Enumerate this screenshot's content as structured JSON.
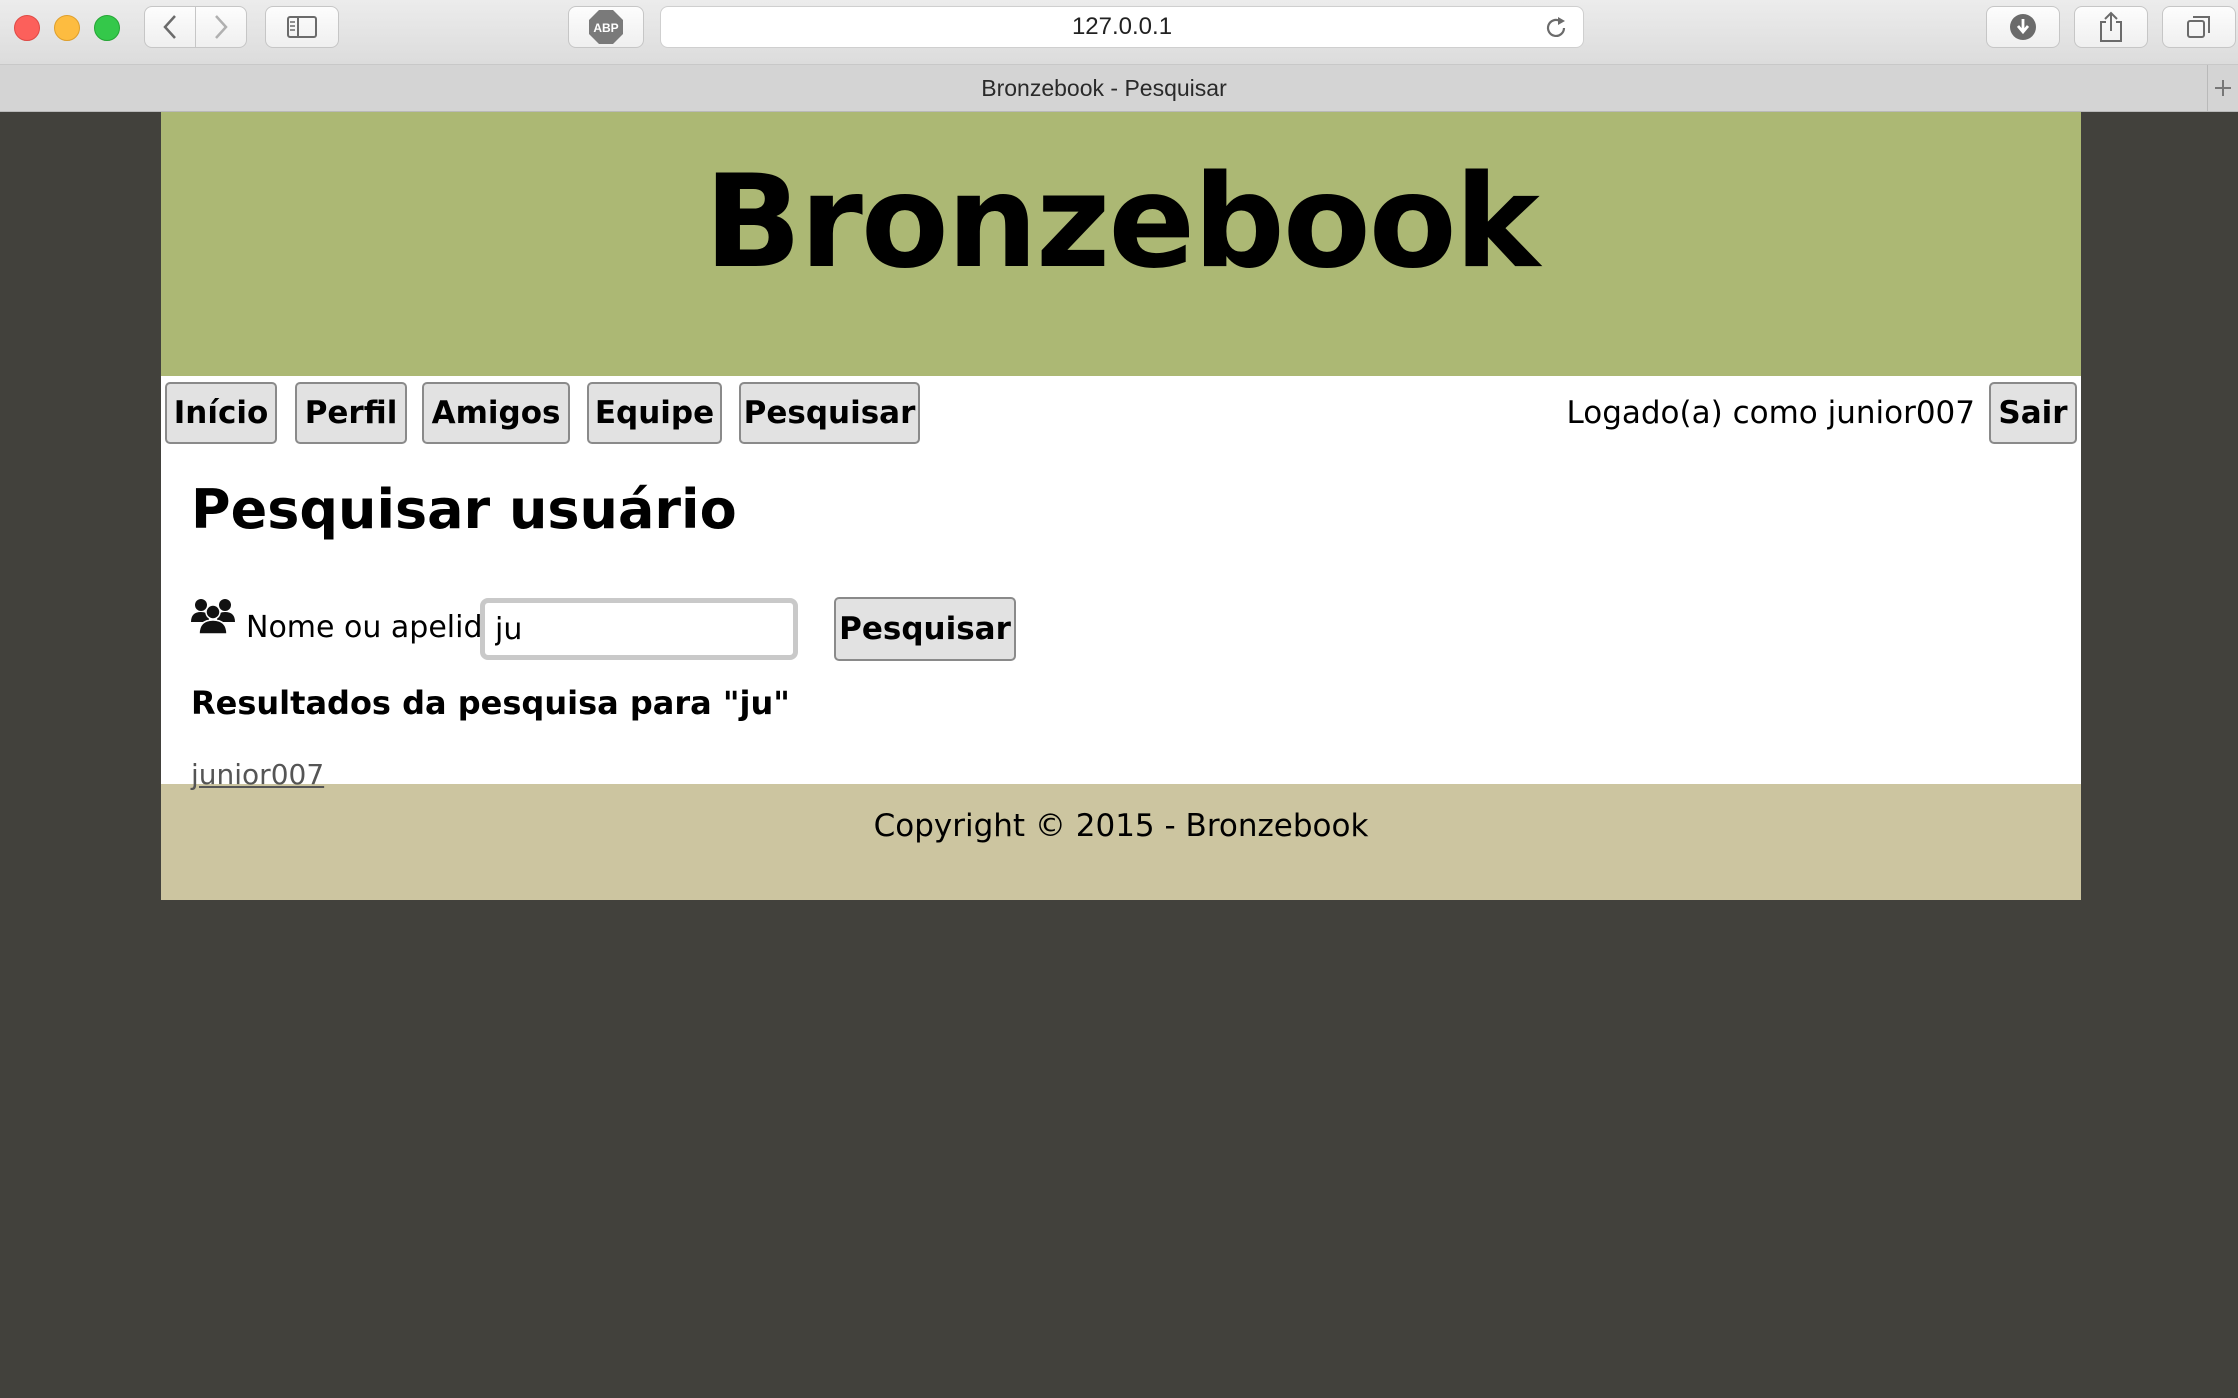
{
  "browser": {
    "url": "127.0.0.1",
    "tab_title": "Bronzebook - Pesquisar",
    "abp_label": "ABP"
  },
  "site": {
    "title": "Bronzebook"
  },
  "menu": {
    "items": [
      {
        "label": "Início"
      },
      {
        "label": "Perfil"
      },
      {
        "label": "Amigos"
      },
      {
        "label": "Equipe"
      },
      {
        "label": "Pesquisar"
      }
    ],
    "logged_in_text": "Logado(a) como junior007",
    "logout_label": "Sair"
  },
  "search": {
    "heading": "Pesquisar usuário",
    "label": "Nome ou apelido:",
    "value": "ju",
    "button_label": "Pesquisar",
    "results_title": "Resultados da pesquisa para \"ju\"",
    "results": [
      "junior007"
    ]
  },
  "footer": {
    "text": "Copyright © 2015 - Bronzebook"
  },
  "colors": {
    "background": "#42413c",
    "banner": "#acb874",
    "footer": "#ccc5a0"
  }
}
